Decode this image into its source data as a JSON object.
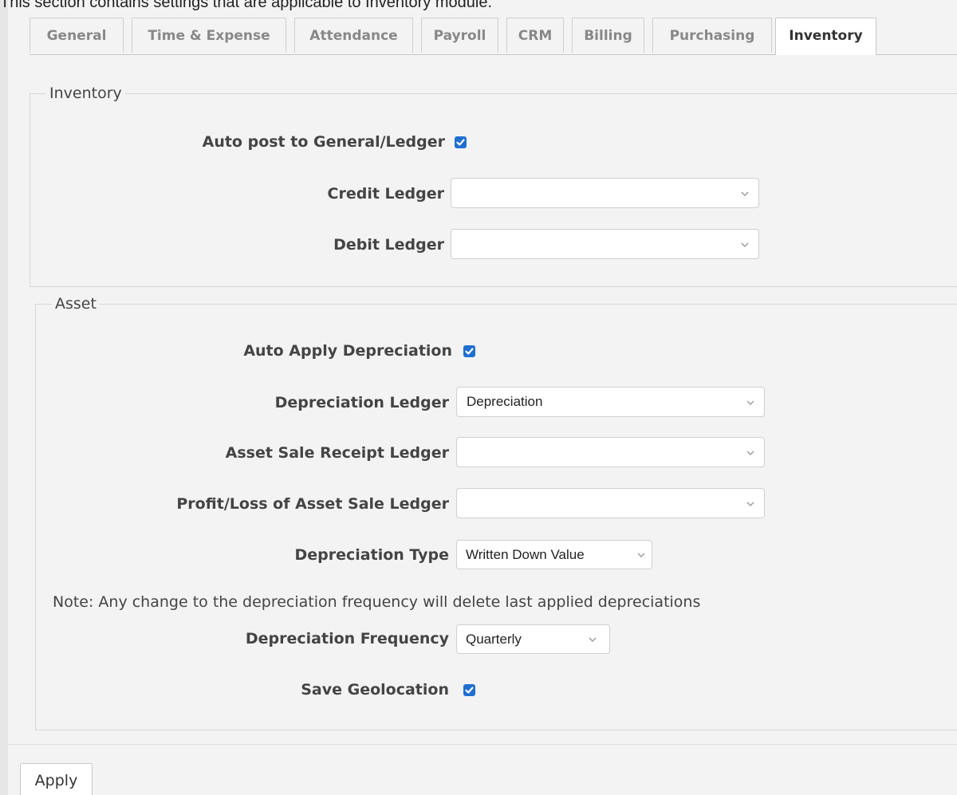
{
  "intro_text": "This section contains settings that are applicable to Inventory module.",
  "tabs": [
    {
      "label": "General",
      "active": false
    },
    {
      "label": "Time & Expense",
      "active": false
    },
    {
      "label": "Attendance",
      "active": false
    },
    {
      "label": "Payroll",
      "active": false
    },
    {
      "label": "CRM",
      "active": false
    },
    {
      "label": "Billing",
      "active": false
    },
    {
      "label": "Purchasing",
      "active": false
    },
    {
      "label": "Inventory",
      "active": true
    }
  ],
  "inventory": {
    "legend": "Inventory",
    "auto_post_label": "Auto post to General/Ledger",
    "auto_post_checked": true,
    "credit_ledger_label": "Credit Ledger",
    "credit_ledger_value": "",
    "debit_ledger_label": "Debit Ledger",
    "debit_ledger_value": ""
  },
  "asset": {
    "legend": "Asset",
    "auto_apply_label": "Auto Apply Depreciation",
    "auto_apply_checked": true,
    "depreciation_ledger_label": "Depreciation Ledger",
    "depreciation_ledger_value": "Depreciation",
    "sale_receipt_label": "Asset Sale Receipt Ledger",
    "sale_receipt_value": "",
    "profit_loss_label": "Profit/Loss of Asset Sale Ledger",
    "profit_loss_value": "",
    "depreciation_type_label": "Depreciation Type",
    "depreciation_type_value": "Written Down Value",
    "note": "Note: Any change to the depreciation frequency will delete last applied depreciations",
    "frequency_label": "Depreciation Frequency",
    "frequency_value": "Quarterly",
    "geolocation_label": "Save Geolocation",
    "geolocation_checked": true
  },
  "apply_label": "Apply",
  "colors": {
    "checkbox": "#1f6fd0",
    "background": "#f3f3f3"
  }
}
